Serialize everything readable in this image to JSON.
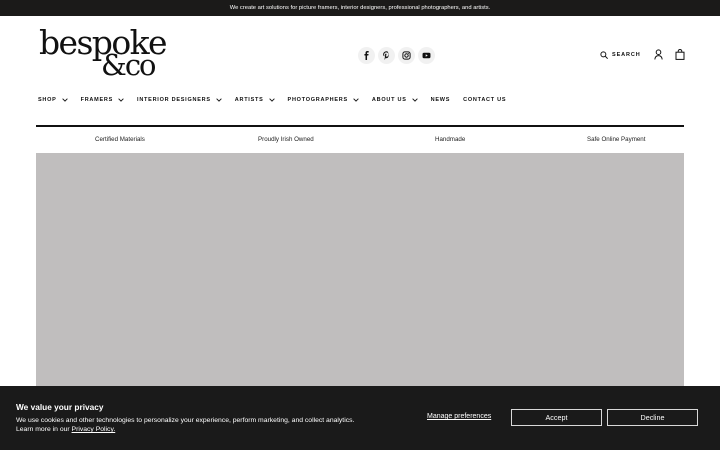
{
  "announcement": {
    "text": "We create art solutions for picture framers, interior designers, professional photographers, and artists."
  },
  "logo": {
    "line1": "bespoke",
    "line2": "&co"
  },
  "social": [
    {
      "name": "facebook-icon"
    },
    {
      "name": "pinterest-icon"
    },
    {
      "name": "instagram-icon"
    },
    {
      "name": "youtube-icon"
    }
  ],
  "header": {
    "search_label": "SEARCH",
    "account_icon": "user-icon",
    "cart_icon": "shopping-bag-icon"
  },
  "nav": {
    "items": [
      {
        "label": "SHOP",
        "has_dropdown": true
      },
      {
        "label": "FRAMERS",
        "has_dropdown": true
      },
      {
        "label": "INTERIOR DESIGNERS",
        "has_dropdown": true
      },
      {
        "label": "ARTISTS",
        "has_dropdown": true
      },
      {
        "label": "PHOTOGRAPHERS",
        "has_dropdown": true
      },
      {
        "label": "ABOUT US",
        "has_dropdown": true
      },
      {
        "label": "NEWS",
        "has_dropdown": false
      },
      {
        "label": "CONTACT US",
        "has_dropdown": false
      }
    ]
  },
  "usps": [
    "Certified Materials",
    "Proudly Irish Owned",
    "Handmade",
    "Safe Online Payment"
  ],
  "hero": {
    "color": "#c0bebe"
  },
  "cookie": {
    "title": "We value your privacy",
    "body_line1": "We use cookies and other technologies to personalize your experience, perform marketing, and collect analytics.",
    "body_prefix": "Learn more in our",
    "policy_link": "Privacy Policy.",
    "manage_label": "Manage preferences",
    "accept_label": "Accept",
    "decline_label": "Decline"
  },
  "colors": {
    "banner_bg": "#1b1a19",
    "cookie_bg": "#1a1a1a",
    "text": "#111111"
  }
}
